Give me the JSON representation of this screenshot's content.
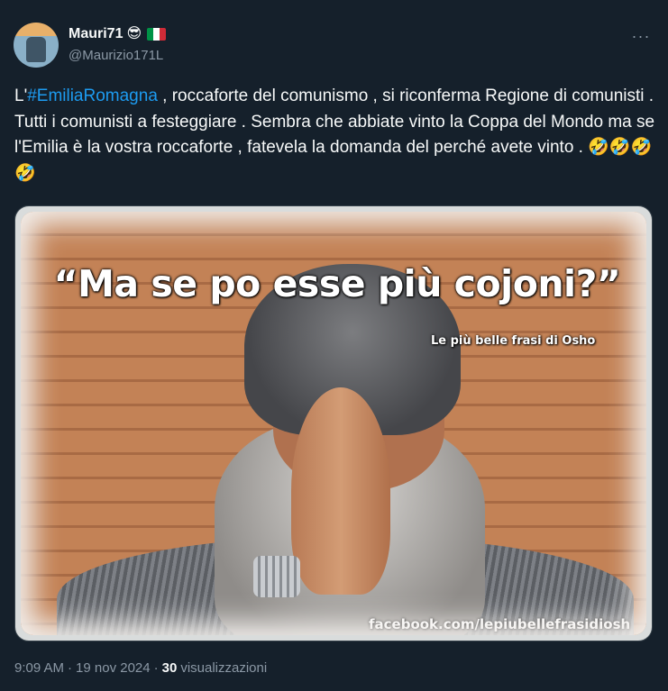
{
  "author": {
    "display_name": "Mauri71",
    "emoji": "😎",
    "flag_colors": [
      "#009246",
      "#ffffff",
      "#ce2b37"
    ],
    "handle": "@Maurizio171L"
  },
  "more_icon": "more-dots-icon",
  "more_label": "···",
  "tweet": {
    "prefix": "L'",
    "hashtag": "#EmiliaRomagna",
    "body": " , roccaforte del comunismo , si riconferma Regione di comunisti . Tutti i comunisti a festeggiare . Sembra che abbiate vinto la Coppa del Mondo ma se l'Emilia è  la vostra roccaforte , fatevela la domanda del perché avete vinto . ",
    "emojis": "🤣🤣🤣🤣"
  },
  "media": {
    "quote_text": "“Ma se po esse più cojoni?”",
    "brand_text": "Le più belle frasi di Osho",
    "url_text": "facebook.com/lepiubellefrasidiosh"
  },
  "meta": {
    "time": "9:09 AM",
    "separator": "·",
    "date": "19 nov 2024",
    "views_count": "30",
    "views_label": "visualizzazioni"
  },
  "colors": {
    "background": "#15202b",
    "text": "#f7f9f9",
    "secondary": "#8b98a5",
    "link": "#1d9bf0"
  }
}
